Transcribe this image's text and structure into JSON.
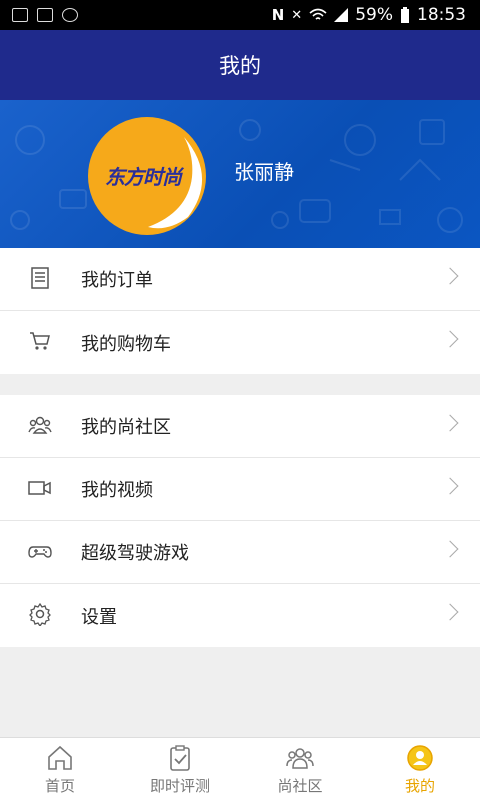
{
  "status_bar": {
    "battery": "59%",
    "time": "18:53"
  },
  "header": {
    "title": "我的"
  },
  "profile": {
    "avatar_text": "东方时尚",
    "username": "张丽静"
  },
  "menu_group_1": [
    {
      "label": "我的订单",
      "icon": "document-icon"
    },
    {
      "label": "我的购物车",
      "icon": "cart-icon"
    }
  ],
  "menu_group_2": [
    {
      "label": "我的尚社区",
      "icon": "community-icon"
    },
    {
      "label": "我的视频",
      "icon": "video-icon"
    },
    {
      "label": "超级驾驶游戏",
      "icon": "gamepad-icon"
    },
    {
      "label": "设置",
      "icon": "gear-icon"
    }
  ],
  "tabs": [
    {
      "label": "首页",
      "icon": "home-icon"
    },
    {
      "label": "即时评测",
      "icon": "clipboard-check-icon"
    },
    {
      "label": "尚社区",
      "icon": "group-icon"
    },
    {
      "label": "我的",
      "icon": "user-circle-icon",
      "active": true
    }
  ],
  "colors": {
    "header_bg": "#1f2a8c",
    "banner_bg": "#0a55c0",
    "accent": "#e8a400"
  }
}
